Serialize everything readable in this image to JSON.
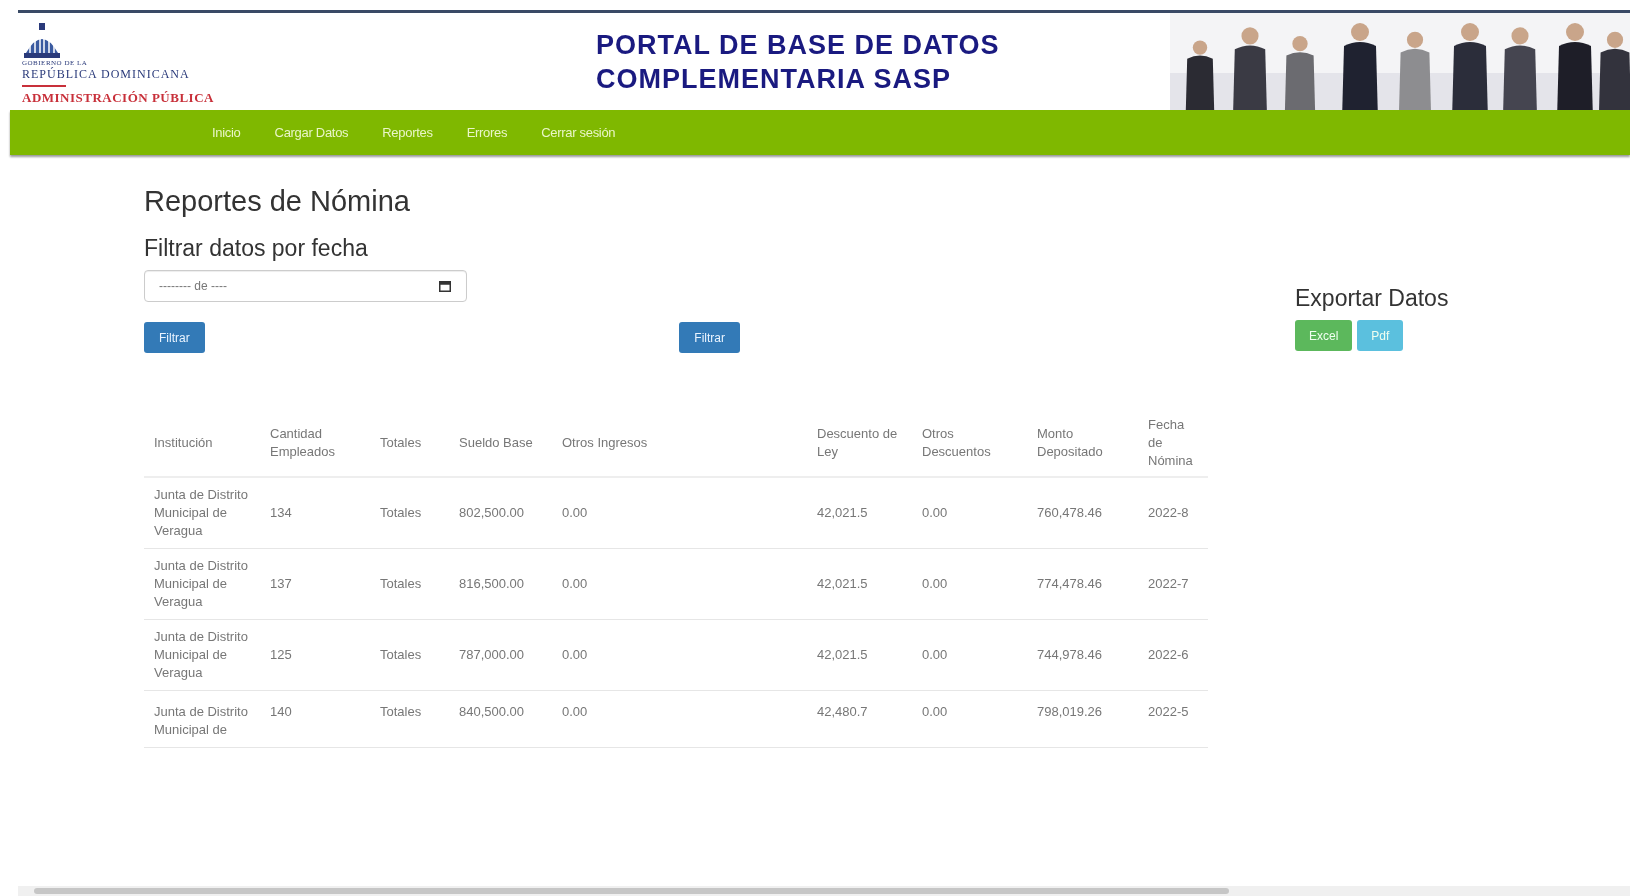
{
  "header": {
    "logo": {
      "line_1": "GOBIERNO DE LA",
      "line_2": "REPÚBLICA DOMINICANA",
      "line_3": "ADMINISTRACIÓN PÚBLICA"
    },
    "title_lines": [
      "PORTAL DE BASE DE DATOS",
      "COMPLEMENTARIA SASP"
    ]
  },
  "nav": {
    "items": [
      {
        "label": "Inicio"
      },
      {
        "label": "Cargar Datos"
      },
      {
        "label": "Reportes"
      },
      {
        "label": "Errores"
      },
      {
        "label": "Cerrar sesión"
      }
    ]
  },
  "page_title": "Reportes de Nómina",
  "filter": {
    "title": "Filtrar datos por fecha",
    "date_placeholder": "-------- de ----",
    "buttons": [
      "Filtrar",
      "Filtrar"
    ]
  },
  "export": {
    "title": "Exportar Datos",
    "buttons": [
      {
        "label": "Excel",
        "kind": "success"
      },
      {
        "label": "Pdf",
        "kind": "info"
      }
    ]
  },
  "table": {
    "columns": [
      "Institución",
      "Cantidad Empleados",
      "Totales",
      "Sueldo Base",
      "Otros Ingresos",
      "Descuento de Ley",
      "Otros Descuentos",
      "Monto Depositado",
      "Fecha de Nómina"
    ],
    "rows": [
      [
        "Junta de Distrito Municipal de Veragua",
        "134",
        "Totales",
        "802,500.00",
        "0.00",
        "42,021.5",
        "0.00",
        "760,478.46",
        "2022-8"
      ],
      [
        "Junta de Distrito Municipal de Veragua",
        "137",
        "Totales",
        "816,500.00",
        "0.00",
        "42,021.5",
        "0.00",
        "774,478.46",
        "2022-7"
      ],
      [
        "Junta de Distrito Municipal de Veragua",
        "125",
        "Totales",
        "787,000.00",
        "0.00",
        "42,021.5",
        "0.00",
        "744,978.46",
        "2022-6"
      ],
      [
        "Junta de Distrito Municipal de",
        "140",
        "Totales",
        "840,500.00",
        "0.00",
        "42,480.7",
        "0.00",
        "798,019.26",
        "2022-5"
      ]
    ]
  }
}
